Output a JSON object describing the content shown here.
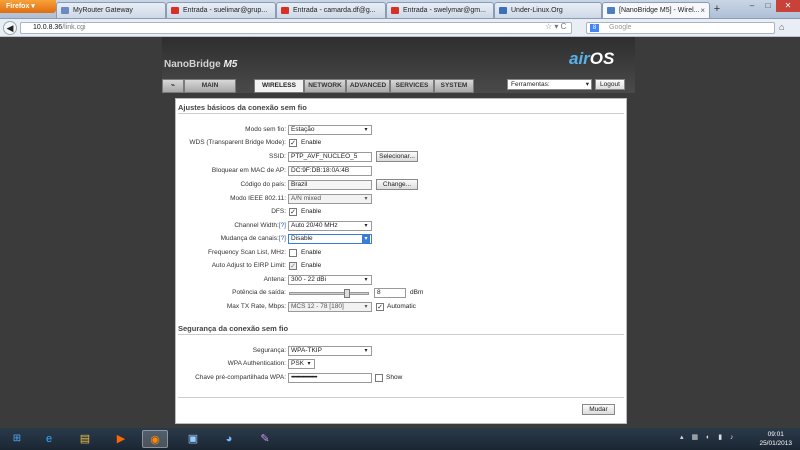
{
  "browser": {
    "app_button": "Firefox",
    "tabs": [
      {
        "title": "MyRouter Gateway",
        "icon": "page-icon",
        "color": "#6a8bbf"
      },
      {
        "title": "Entrada - suelimar@grup...",
        "icon": "gmail-icon",
        "color": "#d93025"
      },
      {
        "title": "Entrada - camarda.df@g...",
        "icon": "gmail-icon",
        "color": "#d93025"
      },
      {
        "title": "Entrada - swelymar@gm...",
        "icon": "gmail-icon",
        "color": "#d93025"
      },
      {
        "title": "Under-Linux.Org",
        "icon": "forum-icon",
        "color": "#3b6fb6"
      },
      {
        "title": "[NanoBridge M5] - Wirel...",
        "icon": "router-icon",
        "color": "#4a7fc1"
      }
    ],
    "url_green": "10.0.8.36",
    "url_path": "/link.cgi",
    "search_placeholder": "Google"
  },
  "router": {
    "brand": "NanoBridge",
    "model": "M5",
    "logo_air": "air",
    "logo_os": "OS",
    "nav_tabs": [
      "MAIN",
      "WIRELESS",
      "NETWORK",
      "ADVANCED",
      "SERVICES",
      "SYSTEM"
    ],
    "tools_select": "Ferramentas:",
    "logout": "Logout"
  },
  "form": {
    "section1_title": "Ajustes básicos da conexão sem fio",
    "wireless_mode_label": "Modo sem fio:",
    "wireless_mode_value": "Estação",
    "wds_label": "WDS (Transparent Bridge Mode):",
    "wds_enable": "Enable",
    "ssid_label": "SSID:",
    "ssid_value": "PTP_AVF_NUCLEO_5",
    "select_button": "Selecionar...",
    "lock_ap_label": "Bloquear em MAC de AP:",
    "lock_ap_value": "DC:9F:DB:18:0A:4B",
    "country_label": "Código do país:",
    "country_value": "Brazil",
    "change_button": "Change...",
    "ieee_label": "Modo IEEE 802.11:",
    "ieee_value": "A/N mixed",
    "dfs_label": "DFS:",
    "dfs_enable": "Enable",
    "channel_width_label": "Channel Width:",
    "channel_width_value": "Auto 20/40 MHz",
    "channel_shift_label": "Mudança de canais:",
    "channel_shift_value": "Disable",
    "help_mark": "[?]",
    "freq_scan_label": "Frequency Scan List, MHz:",
    "freq_scan_enable": "Enable",
    "eirp_label": "Auto Adjust to EIRP Limit:",
    "eirp_enable": "Enable",
    "antenna_label": "Antena:",
    "antenna_value": "300 - 22 dBi",
    "power_label": "Potência de saída:",
    "power_value": "8",
    "power_unit": "dBm",
    "power_level_fraction": 0.73,
    "max_tx_label": "Max TX Rate, Mbps:",
    "max_tx_value": "MCS 12 - 78 [180]",
    "automatic": "Automatic",
    "section2_title": "Segurança da conexão sem fio",
    "security_label": "Segurança:",
    "security_value": "WPA-TKIP",
    "wpa_auth_label": "WPA Authentication:",
    "wpa_auth_value": "PSK",
    "psk_label": "Chave pré-compartilhada WPA:",
    "psk_value": "••••••••••••••••••••",
    "show": "Show",
    "submit": "Mudar"
  },
  "taskbar": {
    "time": "09:01",
    "date": "25/01/2013"
  }
}
